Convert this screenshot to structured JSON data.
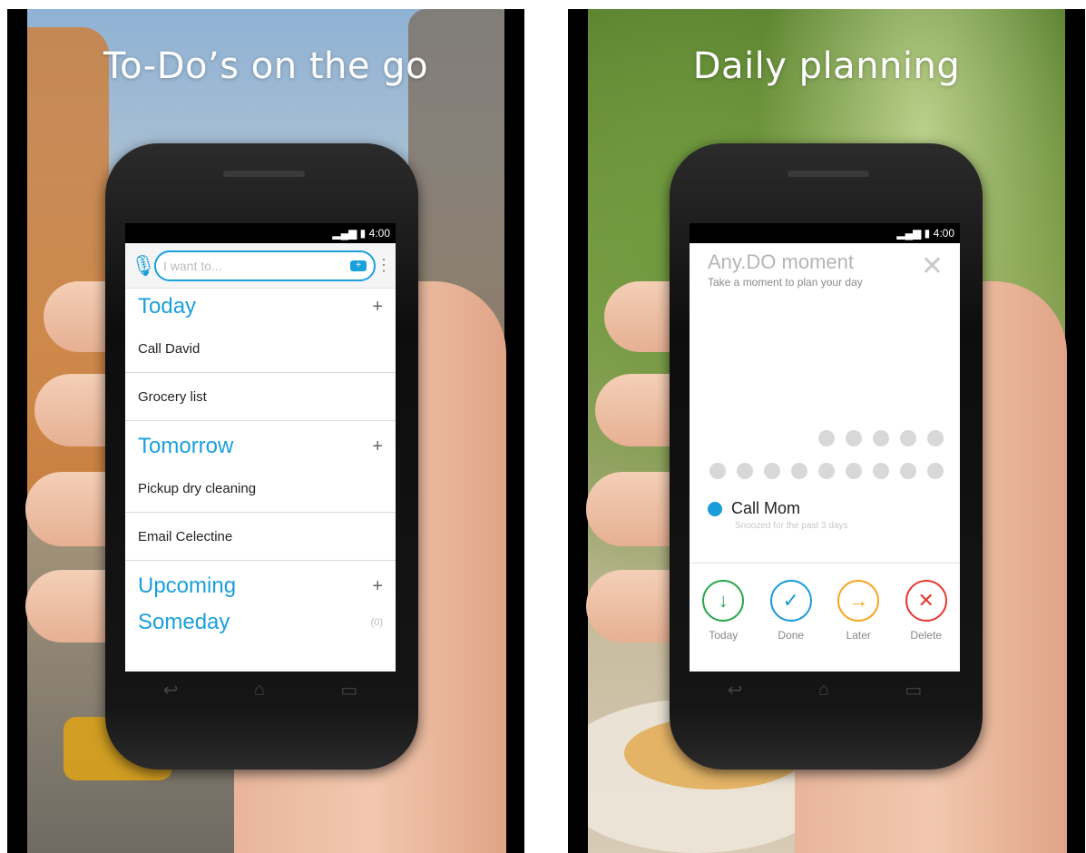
{
  "left_panel": {
    "headline": "To-Do’s on the go",
    "status_time": "4:00",
    "search": {
      "placeholder": "I want to..."
    },
    "sections": [
      {
        "title": "Today",
        "action": "+",
        "items": [
          "Call David",
          "Grocery list"
        ]
      },
      {
        "title": "Tomorrow",
        "action": "+",
        "items": [
          "Pickup dry cleaning",
          "Email Celectine"
        ]
      },
      {
        "title": "Upcoming",
        "action": "+",
        "items": []
      },
      {
        "title": "Someday",
        "count": "(0)",
        "items": []
      }
    ]
  },
  "right_panel": {
    "headline": "Daily planning",
    "status_time": "4:00",
    "moment_title": "Any.DO moment",
    "moment_subtitle": "Take a moment to plan your day",
    "task": {
      "name": "Call Mom",
      "note": "Snoozed for the past 3 days"
    },
    "progress": {
      "row1_dots": 5,
      "row2_dots": 9
    },
    "actions": [
      {
        "label": "Today",
        "glyph": "↓",
        "color": "#2aa84a"
      },
      {
        "label": "Done",
        "glyph": "✓",
        "color": "#1a9cd8"
      },
      {
        "label": "Later",
        "glyph": "→",
        "color": "#f5a623"
      },
      {
        "label": "Delete",
        "glyph": "✕",
        "color": "#e53935"
      }
    ]
  },
  "icons": {
    "mic": "microphone-icon",
    "tag": "tag-icon",
    "menu": "overflow-menu-icon",
    "close": "close-icon",
    "nav_back": "back-icon",
    "nav_home": "home-icon",
    "nav_recent": "recent-apps-icon"
  },
  "colors": {
    "accent": "#1aa0dc",
    "today": "#2aa84a",
    "later": "#f5a623",
    "delete": "#e53935"
  }
}
